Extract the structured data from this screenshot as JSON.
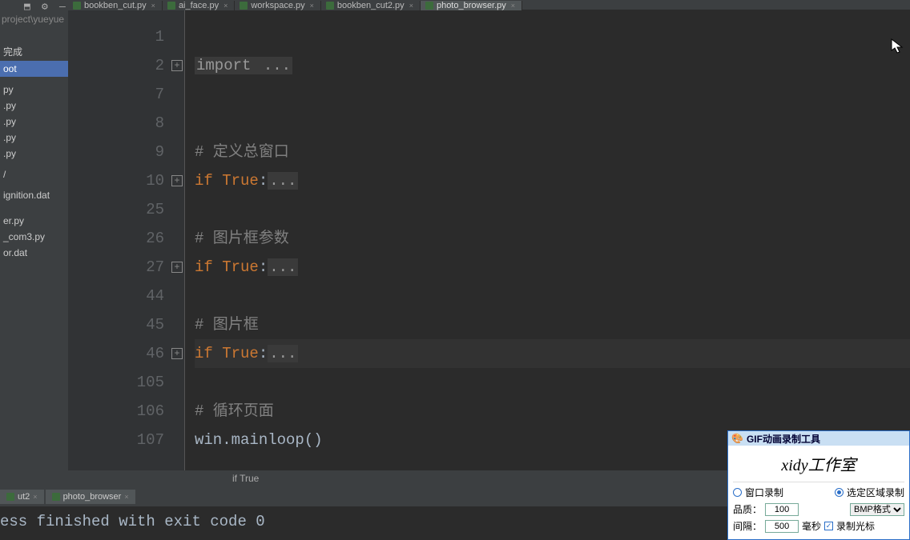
{
  "project": {
    "path": "project\\yueyue",
    "items": [
      {
        "label": "",
        "hi": false
      },
      {
        "label": "",
        "hi": false
      },
      {
        "label": "",
        "hi": false
      },
      {
        "label": "完成",
        "hi": false
      },
      {
        "label": "oot",
        "hi": true
      },
      {
        "label": "",
        "hi": false
      },
      {
        "label": "py",
        "hi": false
      },
      {
        "label": ".py",
        "hi": false
      },
      {
        "label": ".py",
        "hi": false
      },
      {
        "label": ".py",
        "hi": false
      },
      {
        "label": ".py",
        "hi": false
      },
      {
        "label": "",
        "hi": false
      },
      {
        "label": "/",
        "hi": false
      },
      {
        "label": "",
        "hi": false
      },
      {
        "label": "ignition.dat",
        "hi": false
      },
      {
        "label": "",
        "hi": false
      },
      {
        "label": "",
        "hi": false
      },
      {
        "label": "er.py",
        "hi": false
      },
      {
        "label": "_com3.py",
        "hi": false
      },
      {
        "label": "or.dat",
        "hi": false
      }
    ]
  },
  "tabs": [
    {
      "label": "bookben_cut.py",
      "active": false
    },
    {
      "label": "ai_face.py",
      "active": false
    },
    {
      "label": "workspace.py",
      "active": false
    },
    {
      "label": "bookben_cut2.py",
      "active": false
    },
    {
      "label": "photo_browser.py",
      "active": true
    }
  ],
  "code_lines": [
    {
      "num": "1",
      "fold": false,
      "html": ""
    },
    {
      "num": "2",
      "fold": true,
      "html": "<span class='kw folded'>import </span><span class='folded'>...</span>"
    },
    {
      "num": "7",
      "fold": false,
      "html": ""
    },
    {
      "num": "8",
      "fold": false,
      "html": ""
    },
    {
      "num": "9",
      "fold": false,
      "html": "<span class='cm'># 定义总窗口</span>"
    },
    {
      "num": "10",
      "fold": true,
      "html": "<span class='kw'>if </span><span class='kw'>True</span><span class='plain'>:</span><span class='folded'>...</span>"
    },
    {
      "num": "25",
      "fold": false,
      "html": ""
    },
    {
      "num": "26",
      "fold": false,
      "html": "<span class='cm'># 图片框参数</span>"
    },
    {
      "num": "27",
      "fold": true,
      "html": "<span class='kw'>if </span><span class='kw'>True</span><span class='plain'>:</span><span class='folded'>...</span>"
    },
    {
      "num": "44",
      "fold": false,
      "html": ""
    },
    {
      "num": "45",
      "fold": false,
      "html": "<span class='cm'># 图片框</span>"
    },
    {
      "num": "46",
      "fold": true,
      "html": "<span class='kw'>if </span><span class='kw'>True</span><span class='plain'>:</span><span class='folded'>...</span>",
      "current": true
    },
    {
      "num": "105",
      "fold": false,
      "html": ""
    },
    {
      "num": "106",
      "fold": false,
      "html": "<span class='cm'># 循环页面</span>"
    },
    {
      "num": "107",
      "fold": false,
      "html": "<span class='plain'>win.mainloop()</span>"
    }
  ],
  "crumb": "if True",
  "run_tabs": [
    {
      "label": "ut2"
    },
    {
      "label": "photo_browser"
    }
  ],
  "console_output": "ess finished with exit code 0",
  "gif": {
    "title": "GIF动画录制工具",
    "logo": "xidy工作室",
    "radio1": "窗口录制",
    "radio2": "选定区域录制",
    "quality_label": "品质：",
    "quality_value": "100",
    "format": "BMP格式",
    "interval_label": "间隔：",
    "interval_value": "500",
    "unit": "毫秒",
    "chk_label": "录制光标"
  }
}
